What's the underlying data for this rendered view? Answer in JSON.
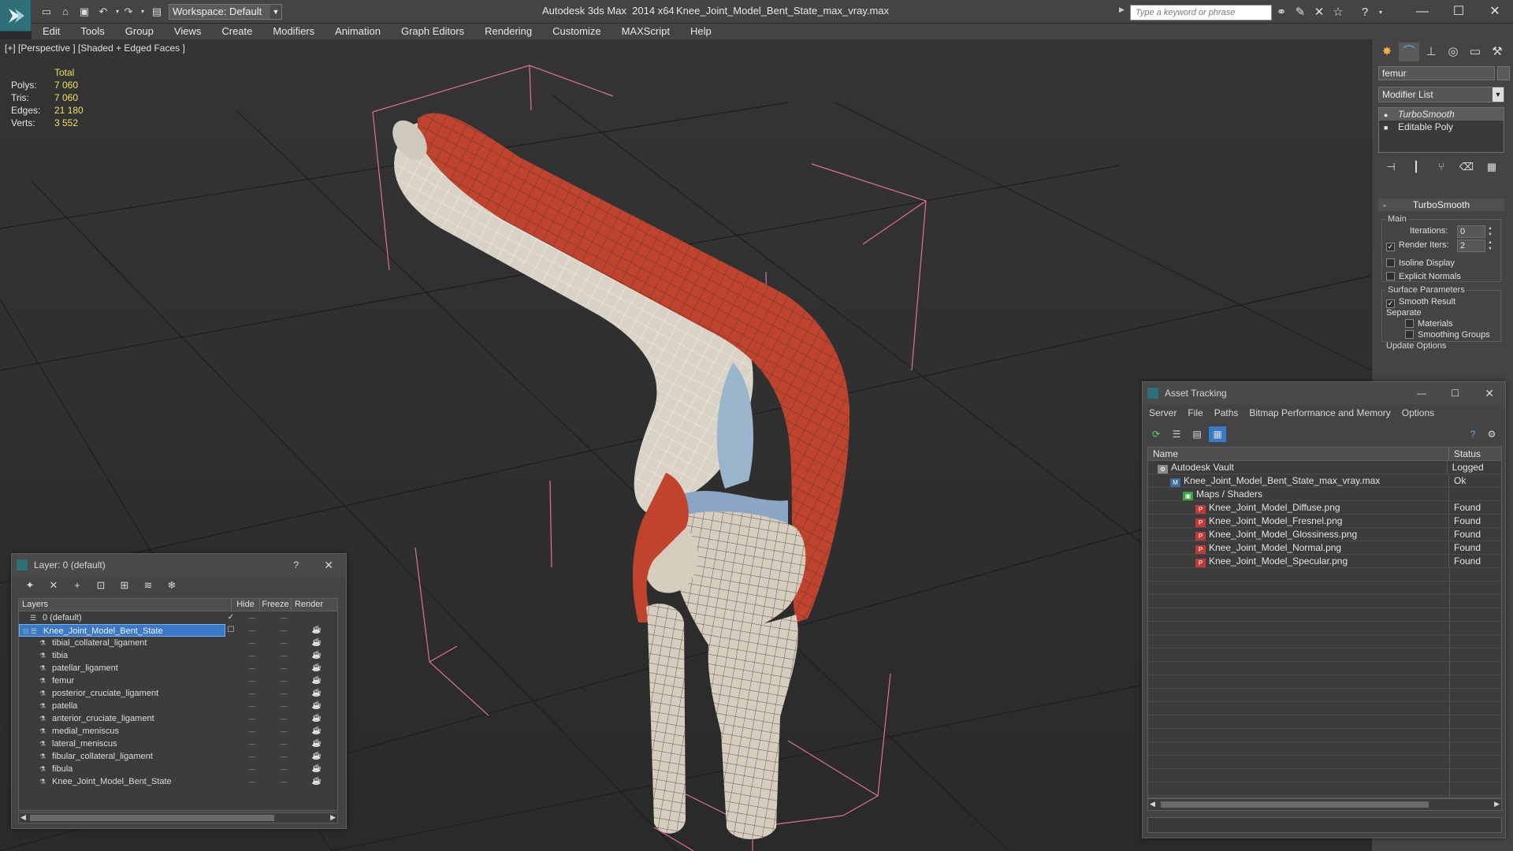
{
  "titlebar": {
    "app_title": "Autodesk 3ds Max  2014 x64",
    "file_title": "Knee_Joint_Model_Bent_State_max_vray.max",
    "workspace": "Workspace: Default",
    "search_placeholder": "Type a keyword or phrase"
  },
  "menu": [
    "Edit",
    "Tools",
    "Group",
    "Views",
    "Create",
    "Modifiers",
    "Animation",
    "Graph Editors",
    "Rendering",
    "Customize",
    "MAXScript",
    "Help"
  ],
  "viewport": {
    "label": "[+] [Perspective ] [Shaded + Edged Faces ]",
    "stats": {
      "header": "Total",
      "rows": [
        {
          "label": "Polys:",
          "value": "7 060"
        },
        {
          "label": "Tris:",
          "value": "7 060"
        },
        {
          "label": "Edges:",
          "value": "21 180"
        },
        {
          "label": "Verts:",
          "value": "3 552"
        }
      ]
    }
  },
  "command_panel": {
    "object_name": "femur",
    "modifier_list": "Modifier List",
    "stack": [
      {
        "label": "TurboSmooth",
        "selected": true
      },
      {
        "label": "Editable Poly",
        "selected": false
      }
    ],
    "rollout": "TurboSmooth",
    "main_group": "Main",
    "iterations_label": "Iterations:",
    "iterations_value": "0",
    "render_iters_label": "Render Iters:",
    "render_iters_value": "2",
    "isoline_label": "Isoline Display",
    "explicit_normals_label": "Explicit Normals",
    "surface_group": "Surface Parameters",
    "smooth_result_label": "Smooth Result",
    "separate_label": "Separate",
    "materials_label": "Materials",
    "smoothing_groups_label": "Smoothing Groups",
    "update_options": "Update Options"
  },
  "layer_explorer": {
    "title": "Layer: 0 (default)",
    "columns": [
      "Layers",
      "Hide",
      "Freeze",
      "Render"
    ],
    "rows": [
      {
        "name": "0 (default)",
        "level": 0,
        "selected": false
      },
      {
        "name": "Knee_Joint_Model_Bent_State",
        "level": 0,
        "selected": true
      },
      {
        "name": "tibial_collateral_ligament",
        "level": 1,
        "selected": false
      },
      {
        "name": "tibia",
        "level": 1,
        "selected": false
      },
      {
        "name": "patellar_ligament",
        "level": 1,
        "selected": false
      },
      {
        "name": "femur",
        "level": 1,
        "selected": false
      },
      {
        "name": "posterior_cruciate_ligament",
        "level": 1,
        "selected": false
      },
      {
        "name": "patella",
        "level": 1,
        "selected": false
      },
      {
        "name": "anterior_cruciate_ligament",
        "level": 1,
        "selected": false
      },
      {
        "name": "medial_meniscus",
        "level": 1,
        "selected": false
      },
      {
        "name": "lateral_meniscus",
        "level": 1,
        "selected": false
      },
      {
        "name": "fibular_collateral_ligament",
        "level": 1,
        "selected": false
      },
      {
        "name": "fibula",
        "level": 1,
        "selected": false
      },
      {
        "name": "Knee_Joint_Model_Bent_State",
        "level": 1,
        "selected": false
      }
    ]
  },
  "asset_tracking": {
    "title": "Asset Tracking",
    "menu": [
      "Server",
      "File",
      "Paths",
      "Bitmap Performance and Memory",
      "Options"
    ],
    "columns": [
      "Name",
      "Status"
    ],
    "rows": [
      {
        "name": "Autodesk Vault",
        "status": "Logged Out",
        "level": 0,
        "icon": "vault-icon"
      },
      {
        "name": "Knee_Joint_Model_Bent_State_max_vray.max",
        "status": "Ok",
        "level": 1,
        "icon": "max-file-icon"
      },
      {
        "name": "Maps / Shaders",
        "status": "",
        "level": 2,
        "icon": "maps-folder-icon"
      },
      {
        "name": "Knee_Joint_Model_Diffuse.png",
        "status": "Found",
        "level": 3,
        "icon": "png-icon"
      },
      {
        "name": "Knee_Joint_Model_Fresnel.png",
        "status": "Found",
        "level": 3,
        "icon": "png-icon"
      },
      {
        "name": "Knee_Joint_Model_Glossiness.png",
        "status": "Found",
        "level": 3,
        "icon": "png-icon"
      },
      {
        "name": "Knee_Joint_Model_Normal.png",
        "status": "Found",
        "level": 3,
        "icon": "png-icon"
      },
      {
        "name": "Knee_Joint_Model_Specular.png",
        "status": "Found",
        "level": 3,
        "icon": "png-icon"
      }
    ]
  },
  "colors": {
    "accent": "#2f6f7a",
    "selection": "#3a78c8",
    "muscle": "#c0432e",
    "bone": "#d8d0c4",
    "bounding_box": "#e0709a"
  }
}
